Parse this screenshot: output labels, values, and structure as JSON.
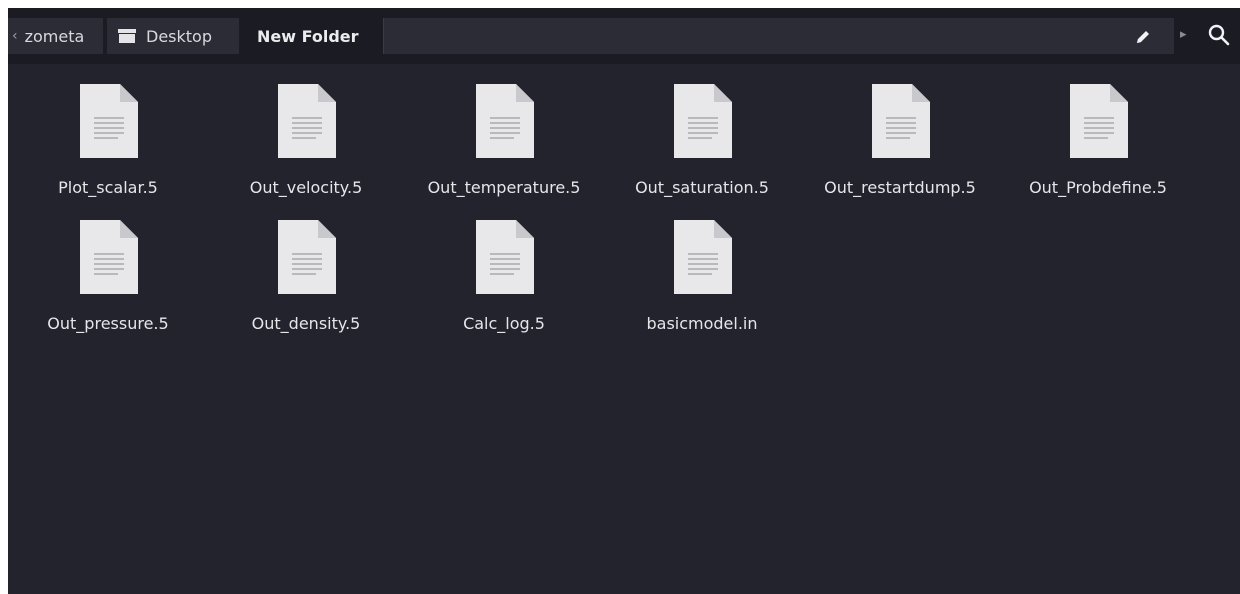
{
  "breadcrumb": {
    "items": [
      {
        "label": "zometa"
      },
      {
        "label": "Desktop"
      },
      {
        "label": "New Folder"
      }
    ]
  },
  "icons": {
    "folder": "folder-icon",
    "edit": "pencil-icon",
    "next": "chevron-right-icon",
    "search": "search-icon",
    "file": "text-document-icon"
  },
  "colors": {
    "background": "#22232c",
    "pathbar": "#1b1c23",
    "crumb": "#2b2c36",
    "text": "#e6e6ea",
    "file_icon": "#e8e8ea"
  },
  "files": [
    {
      "name": "Plot_scalar.5"
    },
    {
      "name": "Out_velocity.5"
    },
    {
      "name": "Out_temperature.5"
    },
    {
      "name": "Out_saturation.5"
    },
    {
      "name": "Out_restartdump.5"
    },
    {
      "name": "Out_Probdefine.5"
    },
    {
      "name": "Out_pressure.5"
    },
    {
      "name": "Out_density.5"
    },
    {
      "name": "Calc_log.5"
    },
    {
      "name": "basicmodel.in"
    }
  ]
}
